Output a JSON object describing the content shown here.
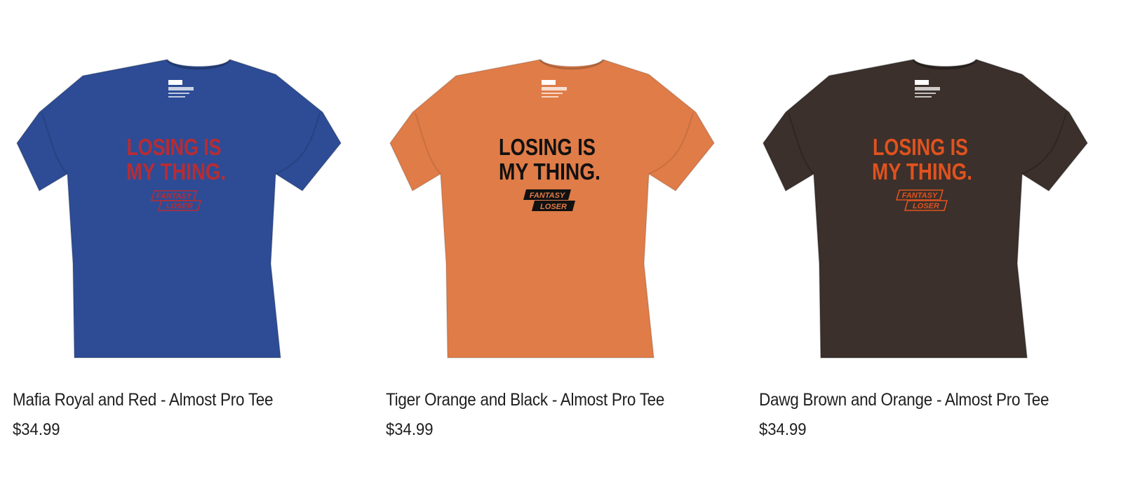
{
  "products": [
    {
      "title": "Mafia Royal and Red - Almost Pro Tee",
      "price": "$34.99",
      "shirt_color": "#2d4c95",
      "print_color": "#b82c33",
      "print_line1": "LOSING IS",
      "print_line2": "MY THING.",
      "logo_word1": "FANTASY",
      "logo_word2": "LOSER",
      "logo_style": "outline"
    },
    {
      "title": "Tiger Orange and Black - Almost Pro Tee",
      "price": "$34.99",
      "shirt_color": "#e07c48",
      "print_color": "#111111",
      "print_line1": "LOSING IS",
      "print_line2": "MY THING.",
      "logo_word1": "FANTASY",
      "logo_word2": "LOSER",
      "logo_style": "filled"
    },
    {
      "title": "Dawg Brown and Orange - Almost Pro Tee",
      "price": "$34.99",
      "shirt_color": "#3b302b",
      "print_color": "#e0521f",
      "print_line1": "LOSING IS",
      "print_line2": "MY THING.",
      "logo_word1": "FANTASY",
      "logo_word2": "LOSER",
      "logo_style": "outline"
    }
  ]
}
